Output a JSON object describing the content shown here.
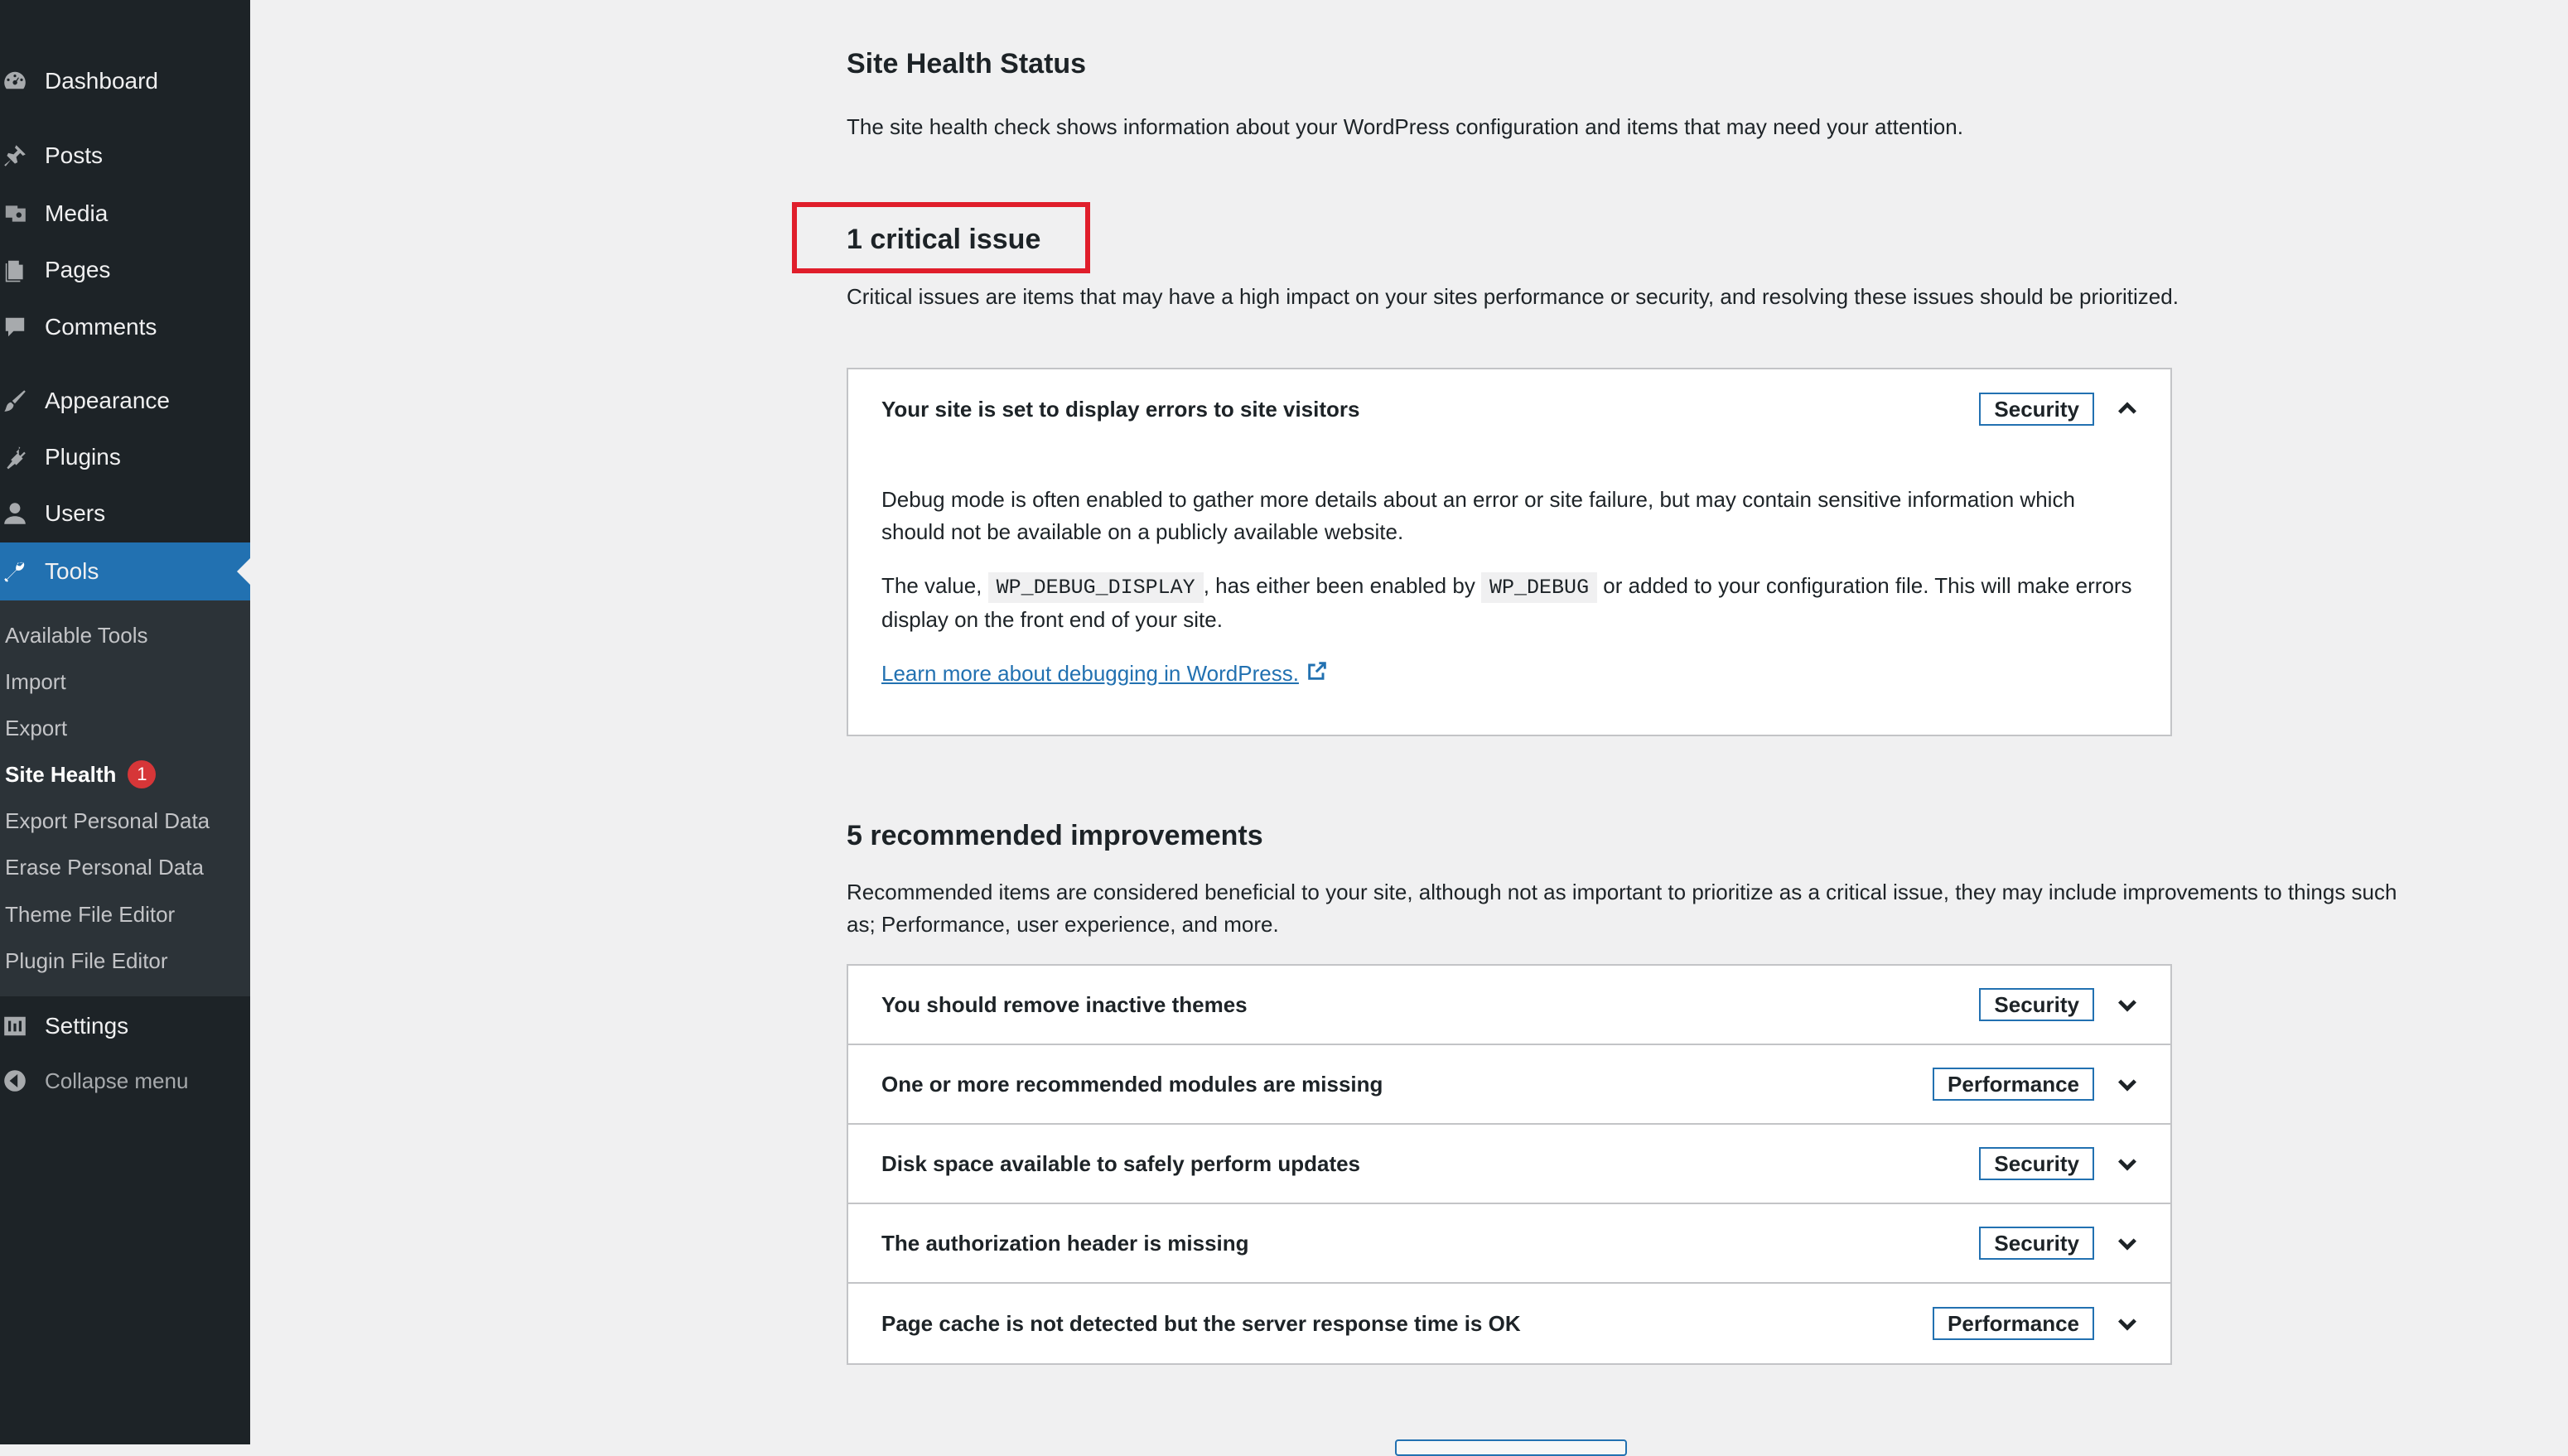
{
  "sidebar": {
    "menu": [
      {
        "label": "Dashboard",
        "icon": "dashboard-icon"
      },
      {
        "label": "Posts",
        "icon": "pin-icon"
      },
      {
        "label": "Media",
        "icon": "media-icon"
      },
      {
        "label": "Pages",
        "icon": "pages-icon"
      },
      {
        "label": "Comments",
        "icon": "comment-icon"
      },
      {
        "label": "Appearance",
        "icon": "brush-icon"
      },
      {
        "label": "Plugins",
        "icon": "plugin-icon"
      },
      {
        "label": "Users",
        "icon": "user-icon"
      },
      {
        "label": "Tools",
        "icon": "wrench-icon"
      }
    ],
    "submenu": [
      {
        "label": "Available Tools"
      },
      {
        "label": "Import"
      },
      {
        "label": "Export"
      },
      {
        "label": "Site Health",
        "badge": "1"
      },
      {
        "label": "Export Personal Data"
      },
      {
        "label": "Erase Personal Data"
      },
      {
        "label": "Theme File Editor"
      },
      {
        "label": "Plugin File Editor"
      }
    ],
    "settings_label": "Settings",
    "collapse_label": "Collapse menu"
  },
  "main": {
    "title": "Site Health Status",
    "intro": "The site health check shows information about your WordPress configuration and items that may need your attention.",
    "critical": {
      "heading": "1 critical issue",
      "description": "Critical issues are items that may have a high impact on your sites performance or security, and resolving these issues should be prioritized.",
      "item": {
        "title": "Your site is set to display errors to site visitors",
        "tag": "Security",
        "para1": "Debug mode is often enabled to gather more details about an error or site failure, but may contain sensitive information which should not be available on a publicly available website.",
        "para2_a": "The value, ",
        "para2_code1": "WP_DEBUG_DISPLAY",
        "para2_b": ", has either been enabled by ",
        "para2_code2": "WP_DEBUG",
        "para2_c": " or added to your configuration file. This will make errors display on the front end of your site.",
        "link": "Learn more about debugging in WordPress."
      }
    },
    "recommended": {
      "heading": "5 recommended improvements",
      "description": "Recommended items are considered beneficial to your site, although not as important to prioritize as a critical issue, they may include improvements to things such as; Performance, user experience, and more.",
      "items": [
        {
          "title": "You should remove inactive themes",
          "tag": "Security"
        },
        {
          "title": "One or more recommended modules are missing",
          "tag": "Performance"
        },
        {
          "title": "Disk space available to safely perform updates",
          "tag": "Security"
        },
        {
          "title": "The authorization header is missing",
          "tag": "Security"
        },
        {
          "title": "Page cache is not detected but the server response time is OK",
          "tag": "Performance"
        }
      ]
    }
  },
  "colors": {
    "sidebar_bg": "#1d2327",
    "submenu_bg": "#2c3338",
    "accent": "#2271b1",
    "badge": "#d63638",
    "highlight": "#e01e2b",
    "page_bg": "#f0f0f1"
  }
}
